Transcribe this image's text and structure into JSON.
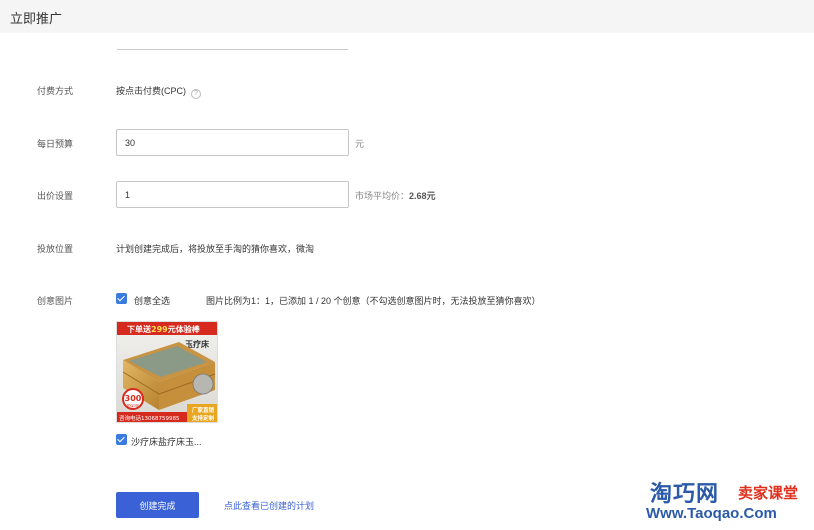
{
  "header": {
    "title": "立即推广"
  },
  "form": {
    "pay_method": {
      "label": "付费方式",
      "value": "按点击付费(CPC)",
      "help": "?"
    },
    "daily_budget": {
      "label": "每日预算",
      "value": "30",
      "unit": "元"
    },
    "bid": {
      "label": "出价设置",
      "value": "1",
      "hint_prefix": "市场平均价：",
      "hint_value": "2.68元"
    },
    "placement": {
      "label": "投放位置",
      "value": "计划创建完成后，将投放至手淘的猜你喜欢，微淘"
    },
    "creative": {
      "label": "创意图片",
      "select_all": "创意全选",
      "note": "图片比例为1：1，已添加 1 / 20 个创意（不勾选创意图片时，无法投放至猜你喜欢）",
      "item_title": "沙疗床盐疗床玉...",
      "image_text": {
        "top_banner_a": "下单送",
        "top_banner_b": "299",
        "top_banner_c": "元体验棒",
        "product_name": "玉疗床",
        "badge_number": "300",
        "badge_label": "质保3年",
        "phone": "咨询电话13068759985",
        "factory_a": "厂家直销",
        "factory_b": "支持定制"
      }
    }
  },
  "actions": {
    "submit": "创建完成",
    "view_link": "点此查看已创建的计划"
  },
  "watermark": {
    "brand_a": "淘巧网",
    "brand_b": "卖家课堂",
    "url": "Www.Taoqao.Com"
  }
}
